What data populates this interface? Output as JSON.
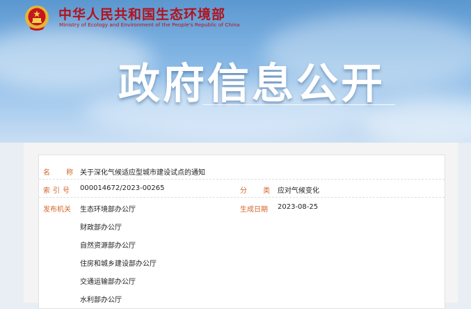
{
  "header": {
    "ministry_cn": "中华人民共和国生态环境部",
    "ministry_en": "Ministry of Ecology and Environment of the People's Republic of China",
    "hero_title": "政府信息公开"
  },
  "colors": {
    "brand_red": "#b3121b",
    "label_orange": "#d4652a",
    "emblem_gold": "#e2b53a"
  },
  "info": {
    "name_label": "名 称",
    "name_value": "关于深化气候适应型城市建设试点的通知",
    "index_label": "索引号",
    "index_value": "000014672/2023-00265",
    "category_label": "分 类",
    "category_value": "应对气候变化",
    "issuer_label": "发布机关",
    "issuers": [
      "生态环境部办公厅",
      "财政部办公厅",
      "自然资源部办公厅",
      "住房和城乡建设部办公厅",
      "交通运输部办公厅",
      "水利部办公厅"
    ],
    "date_label": "生成日期",
    "date_value": "2023-08-25"
  }
}
